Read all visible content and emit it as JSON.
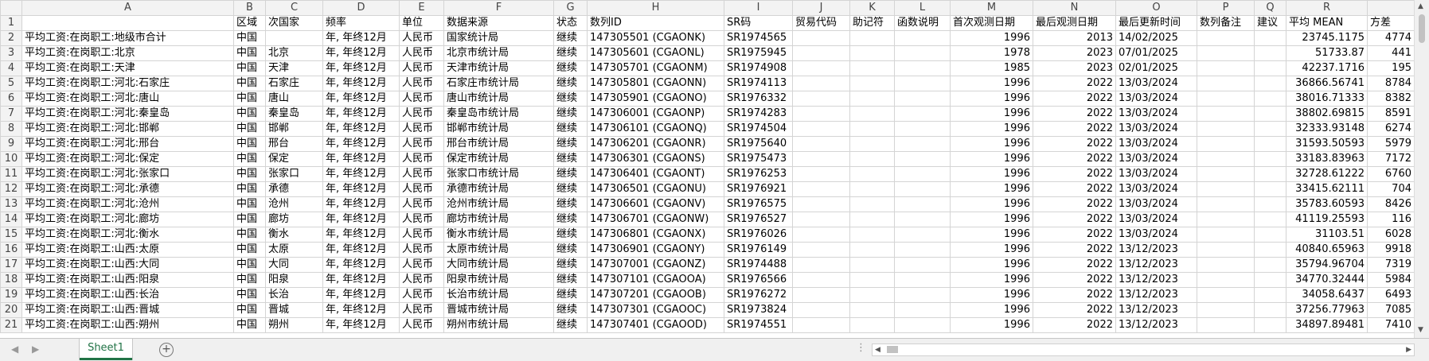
{
  "columns": [
    "A",
    "B",
    "C",
    "D",
    "E",
    "F",
    "G",
    "H",
    "I",
    "J",
    "K",
    "L",
    "M",
    "N",
    "O",
    "P",
    "Q",
    "R",
    ""
  ],
  "header_row": [
    "",
    "区域",
    "次国家",
    "频率",
    "单位",
    "数据来源",
    "状态",
    "数列ID",
    "SR码",
    "贸易代码",
    "助记符",
    "函数说明",
    "首次观测日期",
    "最后观测日期",
    "最后更新时间",
    "数列备注",
    "建议",
    "平均 MEAN",
    "方差"
  ],
  "rows": [
    [
      "平均工资:在岗职工:地级市合计",
      "中国",
      "",
      "年, 年终12月",
      "人民币",
      "国家统计局",
      "继续",
      "147305501 (CGAONK)",
      "SR1974565",
      "",
      "",
      "",
      "1996",
      "2013",
      "14/02/2025",
      "",
      "",
      "23745.1175",
      "4774"
    ],
    [
      "平均工资:在岗职工:北京",
      "中国",
      "北京",
      "年, 年终12月",
      "人民币",
      "北京市统计局",
      "继续",
      "147305601 (CGAONL)",
      "SR1975945",
      "",
      "",
      "",
      "1978",
      "2023",
      "07/01/2025",
      "",
      "",
      "51733.87",
      "441"
    ],
    [
      "平均工资:在岗职工:天津",
      "中国",
      "天津",
      "年, 年终12月",
      "人民币",
      "天津市统计局",
      "继续",
      "147305701 (CGAONM)",
      "SR1974908",
      "",
      "",
      "",
      "1985",
      "2023",
      "02/01/2025",
      "",
      "",
      "42237.1716",
      "195"
    ],
    [
      "平均工资:在岗职工:河北:石家庄",
      "中国",
      "石家庄",
      "年, 年终12月",
      "人民币",
      "石家庄市统计局",
      "继续",
      "147305801 (CGAONN)",
      "SR1974113",
      "",
      "",
      "",
      "1996",
      "2022",
      "13/03/2024",
      "",
      "",
      "36866.56741",
      "8784"
    ],
    [
      "平均工资:在岗职工:河北:唐山",
      "中国",
      "唐山",
      "年, 年终12月",
      "人民币",
      "唐山市统计局",
      "继续",
      "147305901 (CGAONO)",
      "SR1976332",
      "",
      "",
      "",
      "1996",
      "2022",
      "13/03/2024",
      "",
      "",
      "38016.71333",
      "8382"
    ],
    [
      "平均工资:在岗职工:河北:秦皇岛",
      "中国",
      "秦皇岛",
      "年, 年终12月",
      "人民币",
      "秦皇岛市统计局",
      "继续",
      "147306001 (CGAONP)",
      "SR1974283",
      "",
      "",
      "",
      "1996",
      "2022",
      "13/03/2024",
      "",
      "",
      "38802.69815",
      "8591"
    ],
    [
      "平均工资:在岗职工:河北:邯郸",
      "中国",
      "邯郸",
      "年, 年终12月",
      "人民币",
      "邯郸市统计局",
      "继续",
      "147306101 (CGAONQ)",
      "SR1974504",
      "",
      "",
      "",
      "1996",
      "2022",
      "13/03/2024",
      "",
      "",
      "32333.93148",
      "6274"
    ],
    [
      "平均工资:在岗职工:河北:邢台",
      "中国",
      "邢台",
      "年, 年终12月",
      "人民币",
      "邢台市统计局",
      "继续",
      "147306201 (CGAONR)",
      "SR1975640",
      "",
      "",
      "",
      "1996",
      "2022",
      "13/03/2024",
      "",
      "",
      "31593.50593",
      "5979"
    ],
    [
      "平均工资:在岗职工:河北:保定",
      "中国",
      "保定",
      "年, 年终12月",
      "人民币",
      "保定市统计局",
      "继续",
      "147306301 (CGAONS)",
      "SR1975473",
      "",
      "",
      "",
      "1996",
      "2022",
      "13/03/2024",
      "",
      "",
      "33183.83963",
      "7172"
    ],
    [
      "平均工资:在岗职工:河北:张家口",
      "中国",
      "张家口",
      "年, 年终12月",
      "人民币",
      "张家口市统计局",
      "继续",
      "147306401 (CGAONT)",
      "SR1976253",
      "",
      "",
      "",
      "1996",
      "2022",
      "13/03/2024",
      "",
      "",
      "32728.61222",
      "6760"
    ],
    [
      "平均工资:在岗职工:河北:承德",
      "中国",
      "承德",
      "年, 年终12月",
      "人民币",
      "承德市统计局",
      "继续",
      "147306501 (CGAONU)",
      "SR1976921",
      "",
      "",
      "",
      "1996",
      "2022",
      "13/03/2024",
      "",
      "",
      "33415.62111",
      "704"
    ],
    [
      "平均工资:在岗职工:河北:沧州",
      "中国",
      "沧州",
      "年, 年终12月",
      "人民币",
      "沧州市统计局",
      "继续",
      "147306601 (CGAONV)",
      "SR1976575",
      "",
      "",
      "",
      "1996",
      "2022",
      "13/03/2024",
      "",
      "",
      "35783.60593",
      "8426"
    ],
    [
      "平均工资:在岗职工:河北:廊坊",
      "中国",
      "廊坊",
      "年, 年终12月",
      "人民币",
      "廊坊市统计局",
      "继续",
      "147306701 (CGAONW)",
      "SR1976527",
      "",
      "",
      "",
      "1996",
      "2022",
      "13/03/2024",
      "",
      "",
      "41119.25593",
      "116"
    ],
    [
      "平均工资:在岗职工:河北:衡水",
      "中国",
      "衡水",
      "年, 年终12月",
      "人民币",
      "衡水市统计局",
      "继续",
      "147306801 (CGAONX)",
      "SR1976026",
      "",
      "",
      "",
      "1996",
      "2022",
      "13/03/2024",
      "",
      "",
      "31103.51",
      "6028"
    ],
    [
      "平均工资:在岗职工:山西:太原",
      "中国",
      "太原",
      "年, 年终12月",
      "人民币",
      "太原市统计局",
      "继续",
      "147306901 (CGAONY)",
      "SR1976149",
      "",
      "",
      "",
      "1996",
      "2022",
      "13/12/2023",
      "",
      "",
      "40840.65963",
      "9918"
    ],
    [
      "平均工资:在岗职工:山西:大同",
      "中国",
      "大同",
      "年, 年终12月",
      "人民币",
      "大同市统计局",
      "继续",
      "147307001 (CGAONZ)",
      "SR1974488",
      "",
      "",
      "",
      "1996",
      "2022",
      "13/12/2023",
      "",
      "",
      "35794.96704",
      "7319"
    ],
    [
      "平均工资:在岗职工:山西:阳泉",
      "中国",
      "阳泉",
      "年, 年终12月",
      "人民币",
      "阳泉市统计局",
      "继续",
      "147307101 (CGAOOA)",
      "SR1976566",
      "",
      "",
      "",
      "1996",
      "2022",
      "13/12/2023",
      "",
      "",
      "34770.32444",
      "5984"
    ],
    [
      "平均工资:在岗职工:山西:长治",
      "中国",
      "长治",
      "年, 年终12月",
      "人民币",
      "长治市统计局",
      "继续",
      "147307201 (CGAOOB)",
      "SR1976272",
      "",
      "",
      "",
      "1996",
      "2022",
      "13/12/2023",
      "",
      "",
      "34058.6437",
      "6493"
    ],
    [
      "平均工资:在岗职工:山西:晋城",
      "中国",
      "晋城",
      "年, 年终12月",
      "人民币",
      "晋城市统计局",
      "继续",
      "147307301 (CGAOOC)",
      "SR1973824",
      "",
      "",
      "",
      "1996",
      "2022",
      "13/12/2023",
      "",
      "",
      "37256.77963",
      "7085"
    ],
    [
      "平均工资:在岗职工:山西:朔州",
      "中国",
      "朔州",
      "年, 年终12月",
      "人民币",
      "朔州市统计局",
      "继续",
      "147307401 (CGAOOD)",
      "SR1974551",
      "",
      "",
      "",
      "1996",
      "2022",
      "13/12/2023",
      "",
      "",
      "34897.89481",
      "7410"
    ]
  ],
  "sheet_tab": "Sheet1",
  "add_sheet": "+",
  "scroll_dots": "⋮",
  "accent_color": "#217346",
  "icons": {
    "add": "add-sheet-icon",
    "left": "left-arrow-icon",
    "right": "right-arrow-icon"
  }
}
